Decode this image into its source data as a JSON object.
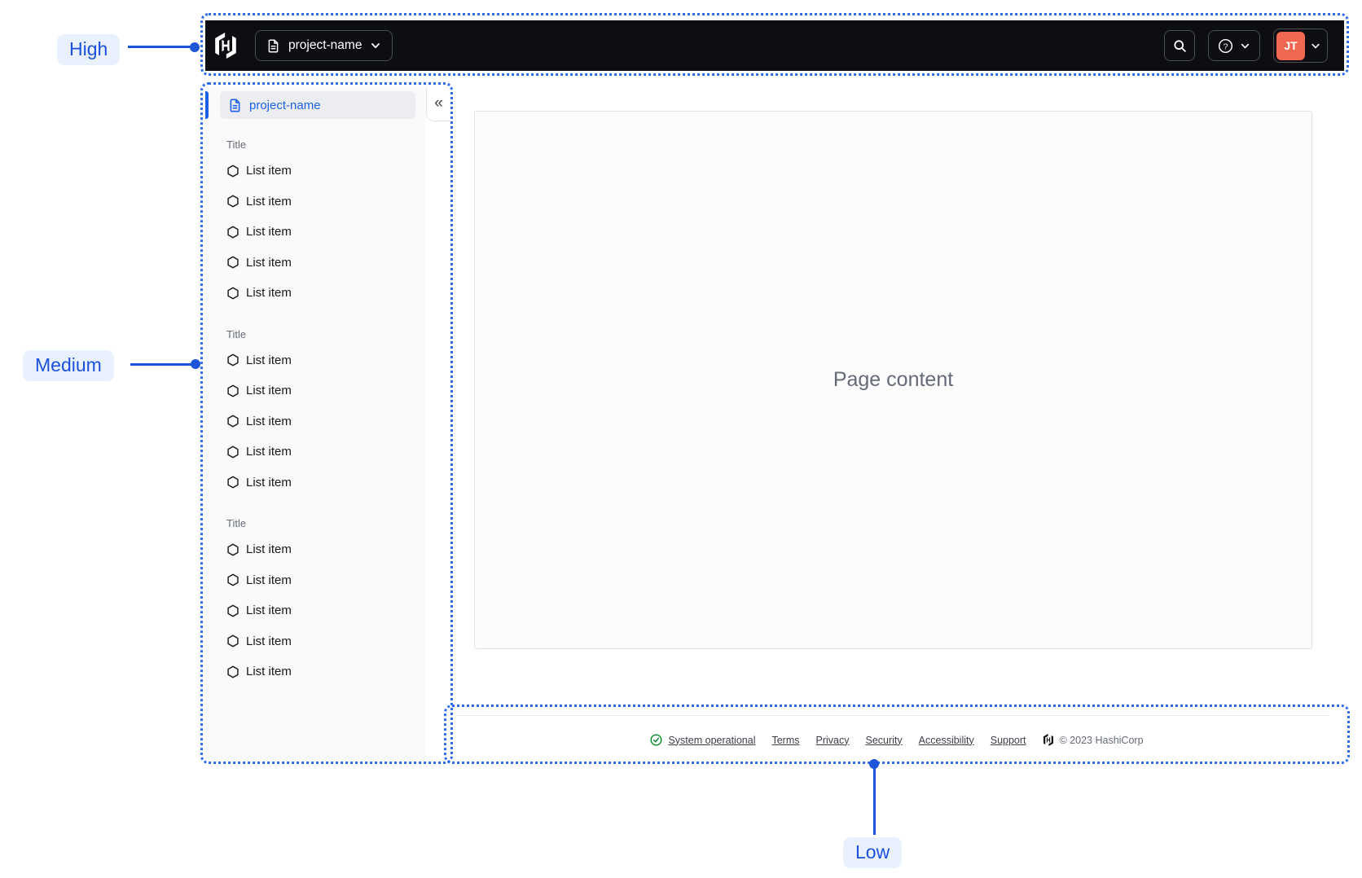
{
  "annotations": {
    "high": "High",
    "medium": "Medium",
    "low": "Low"
  },
  "navbar": {
    "project_menu": {
      "label": "project-name"
    },
    "profile": {
      "initials": "JT"
    },
    "icons": [
      "hashicorp-logo",
      "document-icon",
      "chevron-down-icon",
      "search-icon",
      "help-icon"
    ]
  },
  "sidebar": {
    "active_item": {
      "label": "project-name"
    },
    "collapse_glyph": "«",
    "sections": [
      {
        "title": "Title",
        "items": [
          "List item",
          "List item",
          "List item",
          "List item",
          "List item"
        ]
      },
      {
        "title": "Title",
        "items": [
          "List item",
          "List item",
          "List item",
          "List item",
          "List item"
        ]
      },
      {
        "title": "Title",
        "items": [
          "List item",
          "List item",
          "List item",
          "List item",
          "List item"
        ]
      }
    ],
    "icons": [
      "document-icon",
      "hexagon-icon",
      "collapse-double-chevron-icon"
    ]
  },
  "main": {
    "placeholder": "Page content"
  },
  "footer": {
    "status_label": "System operational",
    "links": [
      "Terms",
      "Privacy",
      "Security",
      "Accessibility",
      "Support"
    ],
    "copyright": "© 2023 HashiCorp",
    "icons": [
      "check-circle-icon",
      "hashicorp-logo"
    ]
  },
  "colors": {
    "navbar_bg": "#0d0e12",
    "accent_blue": "#1c60e9",
    "annotation_blue": "#2d6bf3",
    "annotation_label_bg": "#e9f0fe",
    "annotation_label_text": "#1b51dc",
    "avatar_orange": "#f0684f",
    "success_green": "#008a22",
    "sidebar_bg": "#fafafa",
    "content_border": "#e1e3e7"
  }
}
